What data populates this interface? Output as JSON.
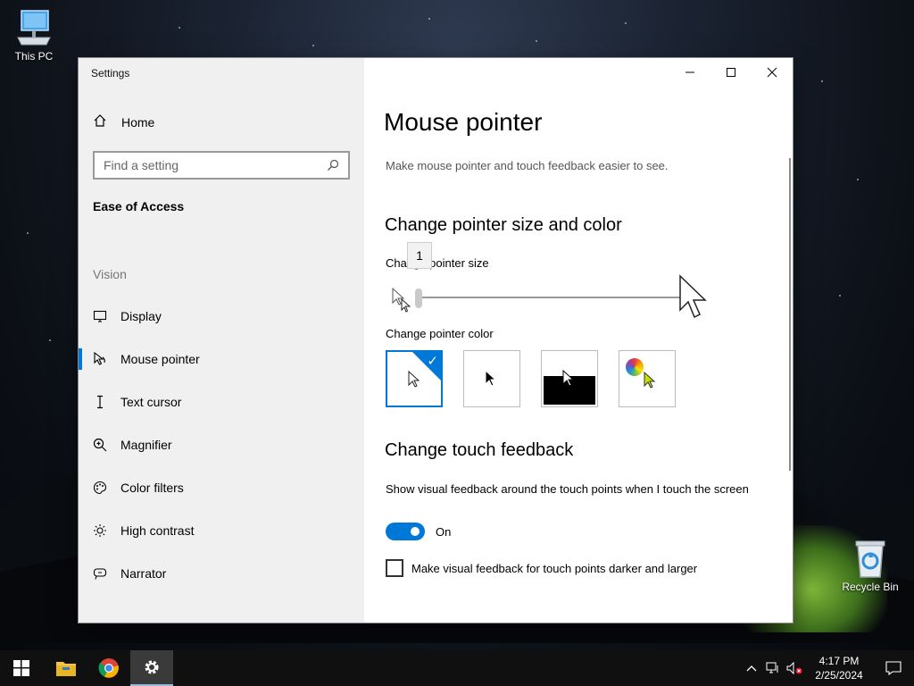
{
  "desktop": {
    "icons": [
      {
        "label": "This PC"
      },
      {
        "label": "Recycle Bin"
      }
    ]
  },
  "window": {
    "app_title": "Settings",
    "controls": [
      "minimize-icon",
      "maximize-icon",
      "close-icon"
    ]
  },
  "sidebar": {
    "home_label": "Home",
    "search_placeholder": "Find a setting",
    "section_title": "Ease of Access",
    "group_label": "Vision",
    "items": [
      {
        "label": "Display",
        "icon": "display-icon"
      },
      {
        "label": "Mouse pointer",
        "icon": "mouse-pointer-icon",
        "active": true
      },
      {
        "label": "Text cursor",
        "icon": "text-cursor-icon"
      },
      {
        "label": "Magnifier",
        "icon": "magnifier-icon"
      },
      {
        "label": "Color filters",
        "icon": "color-filters-icon"
      },
      {
        "label": "High contrast",
        "icon": "high-contrast-icon"
      },
      {
        "label": "Narrator",
        "icon": "narrator-icon"
      }
    ]
  },
  "main": {
    "title": "Mouse pointer",
    "description": "Make mouse pointer and touch feedback easier to see.",
    "pointer_section": {
      "heading": "Change pointer size and color",
      "size_label": "Change pointer size",
      "size_tooltip": "1",
      "size_value": 1,
      "color_label": "Change pointer color",
      "color_options": [
        "white",
        "black",
        "inverted",
        "custom"
      ],
      "selected_color": "white"
    },
    "touch_section": {
      "heading": "Change touch feedback",
      "description": "Show visual feedback around the touch points when I touch the screen",
      "toggle_state": "On",
      "checkbox_label": "Make visual feedback for touch points darker and larger",
      "checkbox_checked": false
    }
  },
  "taskbar": {
    "time": "4:17 PM",
    "date": "2/25/2024",
    "pinned": [
      "file-explorer-icon",
      "chrome-icon",
      "settings-icon"
    ]
  },
  "colors": {
    "accent": "#0078d7",
    "sidebar_bg": "#f0f0f0",
    "taskbar_bg": "#101010"
  }
}
